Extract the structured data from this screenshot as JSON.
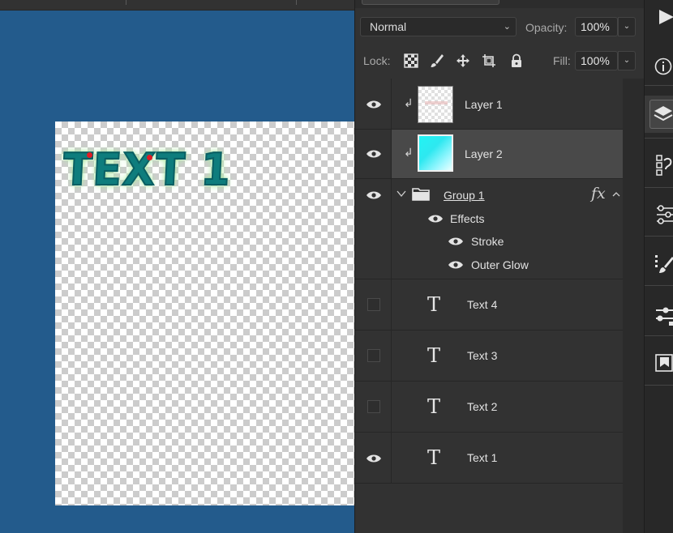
{
  "layers_panel": {
    "blend_mode": "Normal",
    "opacity_label": "Opacity:",
    "opacity_value": "100%",
    "lock_label": "Lock:",
    "fill_label": "Fill:",
    "fill_value": "100%",
    "layers": [
      {
        "name": "Layer 1",
        "visible": true,
        "clipped": true,
        "type": "pixel"
      },
      {
        "name": "Layer 2",
        "visible": true,
        "clipped": true,
        "type": "pixel",
        "selected": true
      },
      {
        "name": "Group 1",
        "visible": true,
        "type": "group",
        "expanded": true,
        "fx": "fx",
        "effects_label": "Effects",
        "effects": [
          "Stroke",
          "Outer Glow"
        ]
      },
      {
        "name": "Text 4",
        "visible": false,
        "type": "text"
      },
      {
        "name": "Text 3",
        "visible": false,
        "type": "text"
      },
      {
        "name": "Text 2",
        "visible": false,
        "type": "text"
      },
      {
        "name": "Text 1",
        "visible": true,
        "type": "text"
      }
    ]
  },
  "canvas": {
    "text": "TEXT 1",
    "canvas_bg": "#235b8c",
    "text_color": "#0e7d7d",
    "glow_color": "#a8e6a0"
  },
  "toolbar_icons": [
    "play-icon",
    "info-icon",
    "layers-icon",
    "glyphs-icon",
    "adjustments-icon",
    "brush-settings-icon",
    "properties-icon",
    "book-icon"
  ]
}
